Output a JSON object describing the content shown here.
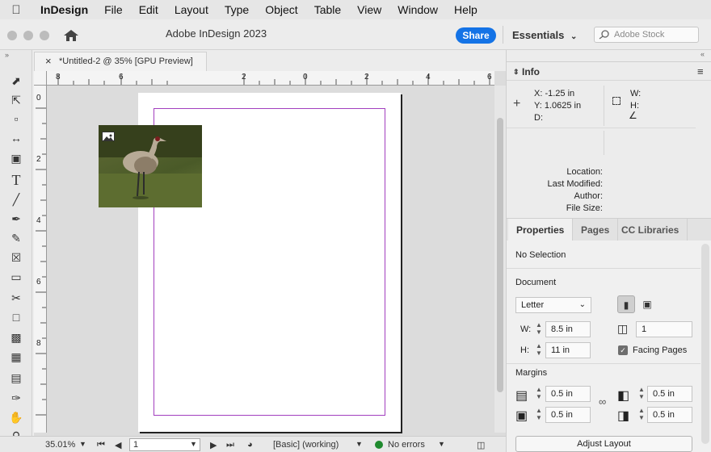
{
  "menubar": {
    "app": "InDesign",
    "items": [
      "File",
      "Edit",
      "Layout",
      "Type",
      "Object",
      "Table",
      "View",
      "Window",
      "Help"
    ]
  },
  "appbar": {
    "title": "Adobe InDesign 2023",
    "share_label": "Share",
    "workspace": "Essentials",
    "stock_placeholder": "Adobe Stock"
  },
  "document": {
    "tab_label": "*Untitled-2 @ 35% [GPU Preview]",
    "close_glyph": "×"
  },
  "rulers": {
    "horizontal": [
      "8",
      "6",
      "2",
      "0",
      "2",
      "4",
      "6"
    ],
    "vertical": [
      "0",
      "2",
      "4",
      "6",
      "8"
    ]
  },
  "statusbar": {
    "zoom": "35.01%",
    "page": "1",
    "preflight_profile": "[Basic] (working)",
    "errors": "No errors"
  },
  "info": {
    "title": "Info",
    "x": "X: -1.25 in",
    "y": "Y: 1.0625 in",
    "d": "D:",
    "w": "W:",
    "h": "H:",
    "location": "Location:",
    "modified": "Last Modified:",
    "author": "Author:",
    "filesize": "File Size:"
  },
  "tabs": [
    "Properties",
    "Pages",
    "CC Libraries"
  ],
  "properties": {
    "selection": "No Selection",
    "document_heading": "Document",
    "page_size": "Letter",
    "w_label": "W:",
    "w_value": "8.5 in",
    "h_label": "H:",
    "h_value": "11 in",
    "pages_value": "1",
    "facing_pages": "Facing Pages",
    "margins_heading": "Margins",
    "margin_top": "0.5 in",
    "margin_bottom": "0.5 in",
    "margin_inside": "0.5 in",
    "margin_outside": "0.5 in",
    "adjust_layout": "Adjust Layout"
  },
  "colors": {
    "accent": "#1473e6",
    "margin_guide": "#a23fbf",
    "status_ok": "#1f8a2e"
  }
}
